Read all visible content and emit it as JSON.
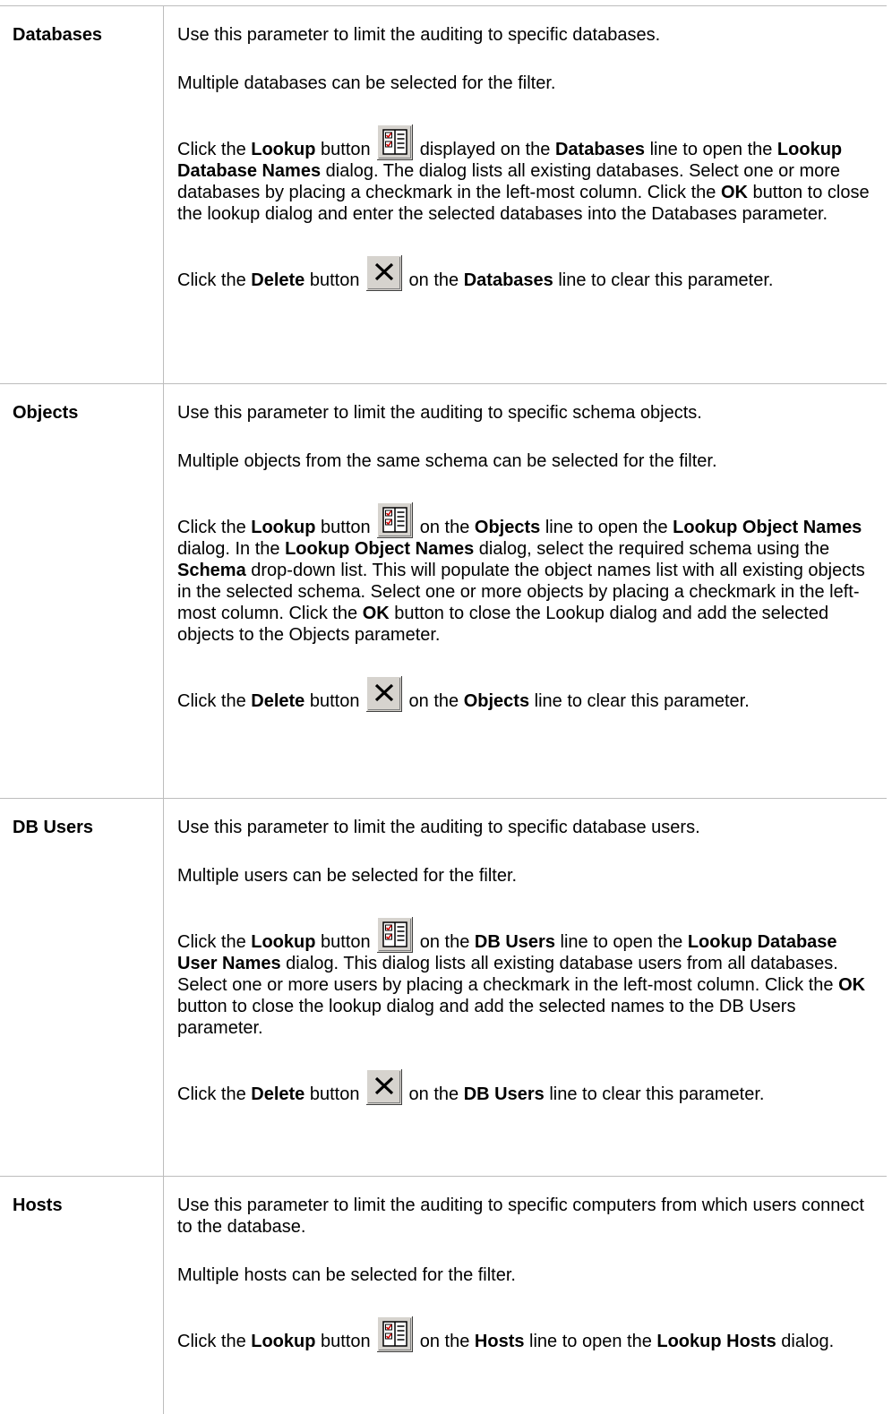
{
  "rows": [
    {
      "term": "Databases",
      "intro": "Use this parameter to limit the auditing to specific databases.",
      "multi": "Multiple databases can be selected for the filter.",
      "lookup": {
        "t1": "Click the ",
        "b1": "Lookup",
        "t2": " button ",
        "t3": " displayed on the ",
        "b2": "Databases",
        "t4": " line to open the ",
        "b3": "Lookup Database Names",
        "t5": " dialog. The dialog lists all existing databases. Select one or more databases by placing a checkmark in the left-most column. Click the ",
        "b4": "OK",
        "t6": " button to close the lookup dialog and enter the selected databases into the Databases parameter."
      },
      "delete": {
        "t1": "Click the ",
        "b1": "Delete",
        "t2": " button ",
        "t3": " on the ",
        "b2": "Databases",
        "t4": " line to clear this parameter."
      }
    },
    {
      "term": "Objects",
      "intro": "Use this parameter to limit the auditing to specific schema objects.",
      "multi": "Multiple objects from the same schema can be selected for the filter.",
      "lookup": {
        "t1": "Click the ",
        "b1": "Lookup",
        "t2": " button ",
        "t3": " on the ",
        "b2": "Objects",
        "t4": " line to open the ",
        "b3": "Lookup Object Names",
        "t5": " dialog. In the ",
        "b4": "Lookup Object Names",
        "t6": " dialog, select the required schema using the ",
        "b5": "Schema",
        "t7": " drop-down list. This will populate the object names list with all existing objects in the selected schema. Select one or more objects by placing a checkmark in the left-most column. Click the ",
        "b6": "OK",
        "t8": " button to close the Lookup dialog and add the selected objects to the Objects parameter."
      },
      "delete": {
        "t1": "Click the ",
        "b1": "Delete",
        "t2": " button ",
        "t3": " on the ",
        "b2": "Objects",
        "t4": " line to clear this parameter."
      }
    },
    {
      "term": "DB Users",
      "intro": "Use this parameter to limit the auditing to specific database users.",
      "multi": "Multiple users can be selected for the filter.",
      "lookup": {
        "t1": "Click the ",
        "b1": "Lookup",
        "t2": " button ",
        "t3": " on the ",
        "b2": "DB Users",
        "t4": " line to open the ",
        "b3": "Lookup Database User Names",
        "t5": " dialog. This dialog lists all existing database users from all databases. Select one or more users by placing a checkmark in the left-most column. Click the ",
        "b4": "OK",
        "t6": " button to close the lookup dialog and add the selected names to the DB Users parameter."
      },
      "delete": {
        "t1": "Click the ",
        "b1": "Delete",
        "t2": " button ",
        "t3": " on the ",
        "b2": "DB Users",
        "t4": " line to clear this parameter."
      }
    },
    {
      "term": "Hosts",
      "intro": "Use this parameter to limit the auditing to specific computers from which users connect to the database.",
      "multi": "Multiple hosts can be selected for the filter.",
      "lookup": {
        "t1": "Click the ",
        "b1": "Lookup",
        "t2": " button ",
        "t3": " on the ",
        "b2": "Hosts",
        "t4": " line to open the ",
        "b3": "Lookup Hosts",
        "t5": " dialog."
      }
    }
  ],
  "icons": {
    "lookup": "lookup-icon",
    "delete": "delete-icon"
  }
}
